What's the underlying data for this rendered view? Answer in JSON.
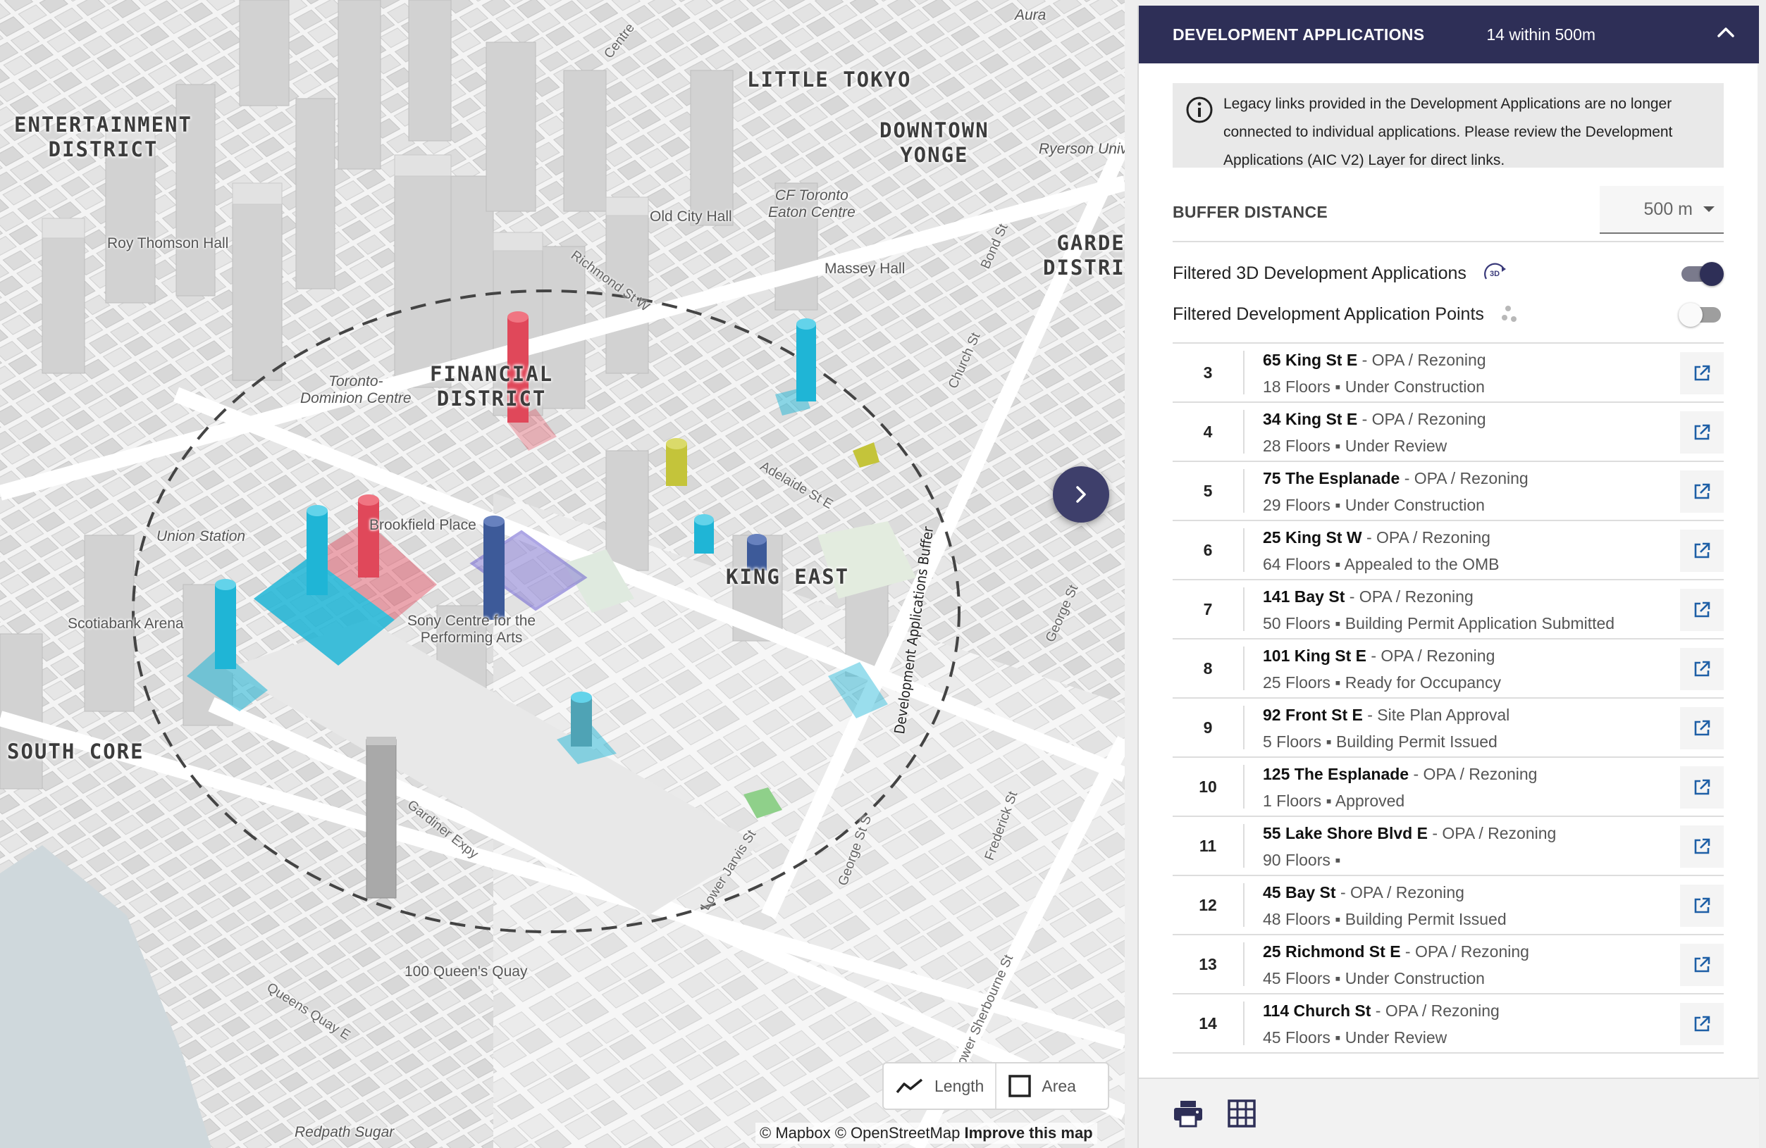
{
  "map": {
    "districts": [
      {
        "id": "entertainment",
        "text": "ENTERTAINMENT\nDISTRICT"
      },
      {
        "id": "little-tokyo",
        "text": "LITTLE TOKYO"
      },
      {
        "id": "downtown-yonge",
        "text": "DOWNTOWN\nYONGE"
      },
      {
        "id": "garden",
        "text": "GARDEN\nDISTRICT"
      },
      {
        "id": "financial",
        "text": "FINANCIAL\nDISTRICT"
      },
      {
        "id": "king-east",
        "text": "KING EAST"
      },
      {
        "id": "south-core",
        "text": "SOUTH CORE"
      }
    ],
    "pois": {
      "aura": "Aura",
      "ryerson": "Ryerson Univ",
      "roy_thomson": "Roy Thomson Hall",
      "old_city_hall": "Old City Hall",
      "cf_toronto": "CF Toronto\nEaton Centre",
      "massey": "Massey Hall",
      "td_centre": "Toronto-\nDominion Centre",
      "union": "Union Station",
      "brookfield": "Brookfield Place",
      "scotiabank": "Scotiabank Arena",
      "sony": "Sony Centre for the\nPerforming Arts",
      "queens_quay_100": "100 Queen's Quay",
      "redpath": "Redpath Sugar"
    },
    "streets": {
      "gardiner": "Gardiner Expy",
      "queens_quay": "Queens Quay E",
      "jarvis": "Lower Jarvis St",
      "george": "George St S",
      "frederick": "Frederick St",
      "sherbourne": "Lower Sherbourne St",
      "george_n": "George St",
      "church": "Church St",
      "bond": "Bond St",
      "centre": "Centre",
      "richmond": "Richmond St W",
      "adelaide": "Adelaide St E"
    },
    "buffer_label": "Development Applications Buffer",
    "measure": {
      "length": "Length",
      "area": "Area"
    },
    "attribution": {
      "text": "© Mapbox © OpenStreetMap",
      "improve": "Improve this map"
    }
  },
  "panel": {
    "title": "DEVELOPMENT APPLICATIONS",
    "count": "14 within 500m",
    "notice": "Legacy links provided in the Development Applications are no longer connected to individual applications. Please review the Development Applications (AIC V2) Layer for direct links.",
    "buffer_label": "BUFFER DISTANCE",
    "buffer_value": "500 m",
    "toggles": [
      {
        "label": "Filtered 3D Development Applications",
        "icon": "3d-icon",
        "on": true
      },
      {
        "label": "Filtered Development Application Points",
        "icon": "points-icon",
        "on": false
      }
    ],
    "applications": [
      {
        "num": "3",
        "address": "65 King St E",
        "type": " - OPA / Rezoning",
        "details": "18 Floors ▪ Under Construction"
      },
      {
        "num": "4",
        "address": "34 King St E",
        "type": " - OPA / Rezoning",
        "details": "28 Floors ▪ Under Review"
      },
      {
        "num": "5",
        "address": "75 The Esplanade",
        "type": " - OPA / Rezoning",
        "details": "29 Floors ▪ Under Construction"
      },
      {
        "num": "6",
        "address": "25 King St W",
        "type": " - OPA / Rezoning",
        "details": "64 Floors ▪ Appealed to the OMB"
      },
      {
        "num": "7",
        "address": "141 Bay St",
        "type": " - OPA / Rezoning",
        "details": "50 Floors ▪ Building Permit Application Submitted"
      },
      {
        "num": "8",
        "address": "101 King St E",
        "type": " - OPA / Rezoning",
        "details": "25 Floors ▪ Ready for Occupancy"
      },
      {
        "num": "9",
        "address": "92 Front St E",
        "type": " - Site Plan Approval",
        "details": "5 Floors ▪ Building Permit Issued"
      },
      {
        "num": "10",
        "address": "125 The Esplanade",
        "type": " - OPA / Rezoning",
        "details": "1 Floors ▪ Approved"
      },
      {
        "num": "11",
        "address": "55 Lake Shore Blvd E",
        "type": " - OPA / Rezoning",
        "details": "90 Floors ▪"
      },
      {
        "num": "12",
        "address": "45 Bay St",
        "type": " - OPA / Rezoning",
        "details": "48 Floors ▪ Building Permit Issued"
      },
      {
        "num": "13",
        "address": "25 Richmond St E",
        "type": " - OPA / Rezoning",
        "details": "45 Floors ▪ Under Construction"
      },
      {
        "num": "14",
        "address": "114 Church St",
        "type": " - OPA / Rezoning",
        "details": "45 Floors ▪ Under Review"
      }
    ],
    "footer": {
      "print_icon": "print-icon",
      "table_icon": "table-icon"
    }
  },
  "colors": {
    "header": "#2e2f57",
    "toggle_on": "#2e2f57",
    "cyan": "#1fb5d6",
    "red": "#e0485a",
    "navy": "#3d5a99",
    "olive": "#c4c43a",
    "purple": "#8a7fd6",
    "link": "#1e5fa6"
  }
}
